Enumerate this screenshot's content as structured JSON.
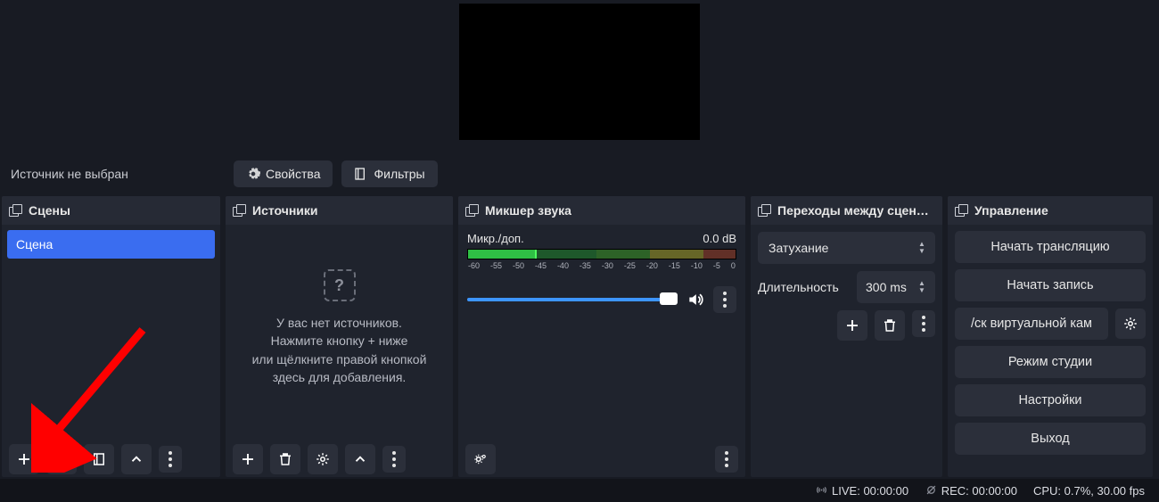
{
  "toolbar": {
    "no_source": "Источник не выбран",
    "properties": "Свойства",
    "filters": "Фильтры"
  },
  "panels": {
    "scenes": "Сцены",
    "sources": "Источники",
    "mixer": "Микшер звука",
    "transitions": "Переходы между сцена…",
    "controls": "Управление"
  },
  "scenes": {
    "items": [
      "Сцена"
    ]
  },
  "sources": {
    "empty_line1": "У вас нет источников.",
    "empty_line2": "Нажмите кнопку + ниже",
    "empty_line3": "или щёлкните правой кнопкой",
    "empty_line4": "здесь для добавления."
  },
  "mixer": {
    "channel_name": "Микр./доп.",
    "db_value": "0.0 dB",
    "ticks": [
      "-60",
      "-55",
      "-50",
      "-45",
      "-40",
      "-35",
      "-30",
      "-25",
      "-20",
      "-15",
      "-10",
      "-5",
      "0"
    ]
  },
  "transitions": {
    "selected": "Затухание",
    "duration_label": "Длительность",
    "duration_value": "300 ms"
  },
  "controls": {
    "start_stream": "Начать трансляцию",
    "start_record": "Начать запись",
    "virtual_cam": "/ск виртуальной кам",
    "studio_mode": "Режим студии",
    "settings": "Настройки",
    "exit": "Выход"
  },
  "status": {
    "live_label": "LIVE:",
    "live_time": "00:00:00",
    "rec_label": "REC:",
    "rec_time": "00:00:00",
    "cpu": "CPU: 0.7%, 30.00 fps"
  }
}
